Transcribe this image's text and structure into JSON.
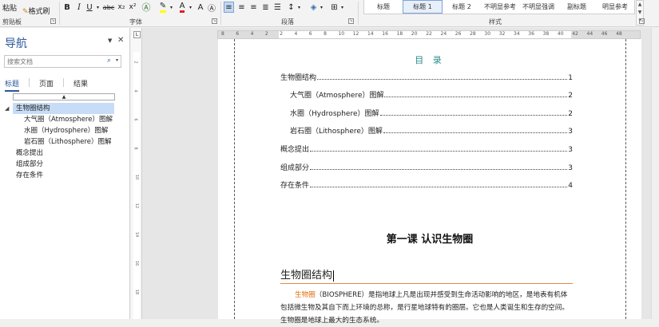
{
  "ribbon": {
    "paste": "粘贴",
    "format_painter": "格式刷",
    "clipboard_label": "剪贴板",
    "font_label": "字体",
    "paragraph_label": "段落",
    "styles_label": "样式",
    "bold": "B",
    "italic": "I",
    "underline": "U",
    "strike": "abc",
    "subscript": "x₂",
    "superscript": "x²",
    "font_color": "A",
    "styles": [
      "标题",
      "标题 1",
      "标题 2",
      "不明显参考",
      "不明显强调",
      "副标题",
      "明显参考"
    ]
  },
  "nav": {
    "title": "导航",
    "search_placeholder": "搜索文档",
    "tabs": [
      "标题",
      "页面",
      "结果"
    ],
    "tree": [
      {
        "label": "生物圈结构",
        "level": 0,
        "selected": true
      },
      {
        "label": "大气圈（Atmosphere）图解",
        "level": 1
      },
      {
        "label": "水圈（Hydrosphere）图解",
        "level": 1
      },
      {
        "label": "岩石圈（Lithosphere）图解",
        "level": 1
      },
      {
        "label": "概念提出",
        "level": 0
      },
      {
        "label": "组成部分",
        "level": 0
      },
      {
        "label": "存在条件",
        "level": 0
      }
    ]
  },
  "ruler": {
    "h_numbers": [
      "8",
      "6",
      "4",
      "2",
      "2",
      "4",
      "6",
      "8",
      "10",
      "12",
      "14",
      "16",
      "18",
      "20",
      "22",
      "24",
      "26",
      "28",
      "30",
      "32",
      "34",
      "36",
      "38",
      "40",
      "42",
      "44",
      "46",
      "48"
    ],
    "v_numbers": [
      "2",
      "4",
      "6",
      "8",
      "10",
      "12",
      "14",
      "16",
      "18"
    ]
  },
  "doc": {
    "toc_title": "目 录",
    "toc": [
      {
        "text": "生物圈结构",
        "page": "1",
        "indent": 0
      },
      {
        "text": "大气圈（Atmosphere）图解",
        "page": "2",
        "indent": 1
      },
      {
        "text": "水圈（Hydrosphere）图解",
        "page": "2",
        "indent": 1
      },
      {
        "text": "岩石圈（Lithosphere）图解",
        "page": "3",
        "indent": 1
      },
      {
        "text": "概念提出",
        "page": "3",
        "indent": 0
      },
      {
        "text": "组成部分",
        "page": "3",
        "indent": 0
      },
      {
        "text": "存在条件",
        "page": "4",
        "indent": 0
      }
    ],
    "lesson_title": "第一课  认识生物圈",
    "heading": "生物圈结构",
    "para_highlight": "生物圈",
    "para_rest": "（BIOSPHERE）是指地球上凡是出现并感受到生命活动影响的地区，是地表有机体包括微生物及其自下而上环境的总称，是行星地球特有的圈层。它也是人类诞生和生存的空间。生物圈是地球上最大的生态系统。"
  }
}
